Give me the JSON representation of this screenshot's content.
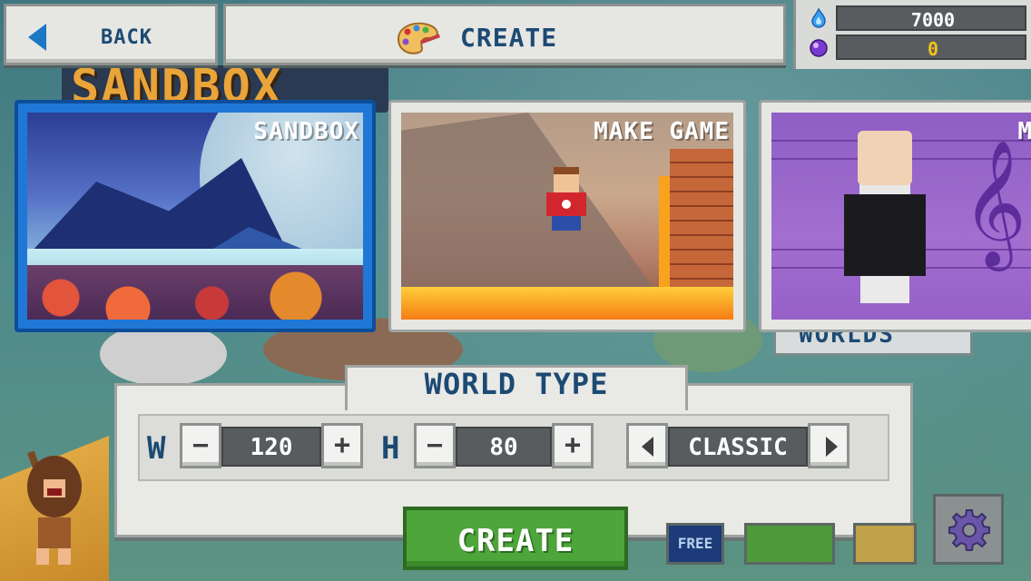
{
  "topbar": {
    "back_label": "BACK",
    "title": "CREATE"
  },
  "currency": {
    "mana": {
      "icon": "blue-flame-icon",
      "value": "7000"
    },
    "gems": {
      "icon": "purple-orb-icon",
      "value": "0"
    }
  },
  "cards": [
    {
      "label": "SANDBOX",
      "selected": true
    },
    {
      "label": "MAKE GAME",
      "selected": false
    },
    {
      "label": "M",
      "selected": false
    }
  ],
  "world_type": {
    "title": "WORLD TYPE",
    "width_label": "W",
    "width_value": "120",
    "height_label": "H",
    "height_value": "80",
    "type_value": "CLASSIC",
    "minus_glyph": "−",
    "plus_glyph": "+"
  },
  "create_button": {
    "label": "CREATE",
    "color": "#4ea53a"
  },
  "background": {
    "title_text": "SANDBOX",
    "worlds_text": "WORLDS",
    "free_badge": "FREE"
  },
  "colors": {
    "accent_blue": "#1f78d6",
    "text_navy": "#1c4a73",
    "gem_yellow": "#f2c21b"
  }
}
